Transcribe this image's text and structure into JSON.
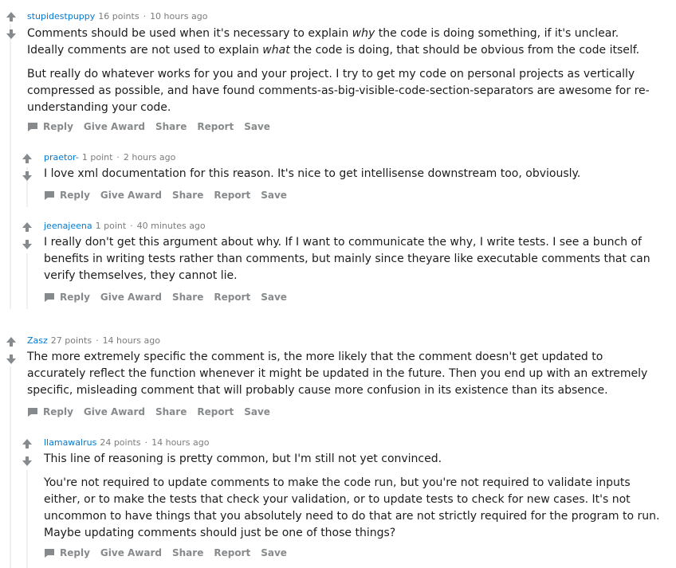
{
  "actions": {
    "reply": "Reply",
    "give_award": "Give Award",
    "share": "Share",
    "report": "Report",
    "save": "Save"
  },
  "comments": [
    {
      "author": "stupidestpuppy",
      "points": "16 points",
      "time": "10 hours ago",
      "paragraphs": [
        [
          "Comments should be used when it's necessary to explain ",
          "why",
          " the code is doing something, if it's unclear. Ideally comments are not used to explain ",
          "what",
          " the code is doing, that should be obvious from the code itself."
        ],
        [
          "But really do whatever works for you and your project. I try to get my code on personal projects as vertically compressed as possible, and have found comments-as-big-visible-code-section-separators are awesome for re-understanding your code."
        ]
      ]
    },
    {
      "author": "praetor-",
      "points": "1 point",
      "time": "2 hours ago",
      "paragraphs": [
        [
          "I love xml documentation for this reason. It's nice to get intellisense downstream too, obviously."
        ]
      ]
    },
    {
      "author": "jeenajeena",
      "points": "1 point",
      "time": "40 minutes ago",
      "paragraphs": [
        [
          "I really don't get this argument about why. If I want to communicate the why, I write tests. I see a bunch of benefits in writing tests rather than comments, but mainly since theyare like executable comments that can verify themselves, they cannot lie."
        ]
      ]
    },
    {
      "author": "Zasz",
      "points": "27 points",
      "time": "14 hours ago",
      "paragraphs": [
        [
          "The more extremely specific the comment is, the more likely that the comment doesn't get updated to accurately reflect the function whenever it might be updated in the future. Then you end up with an extremely specific, misleading comment that will probably cause more confusion in its existence than its absence."
        ]
      ]
    },
    {
      "author": "llamawalrus",
      "points": "24 points",
      "time": "14 hours ago",
      "paragraphs": [
        [
          "This line of reasoning is pretty common, but I'm still not yet convinced."
        ],
        [
          "You're not required to update comments to make the code run, but you're not required to validate inputs either, or to make the tests that check your validation, or to update tests to check for new cases. It's not uncommon to have things that you absolutely need to do that are not strictly required for the program to run. Maybe updating comments should just be one of those things?"
        ]
      ]
    }
  ]
}
